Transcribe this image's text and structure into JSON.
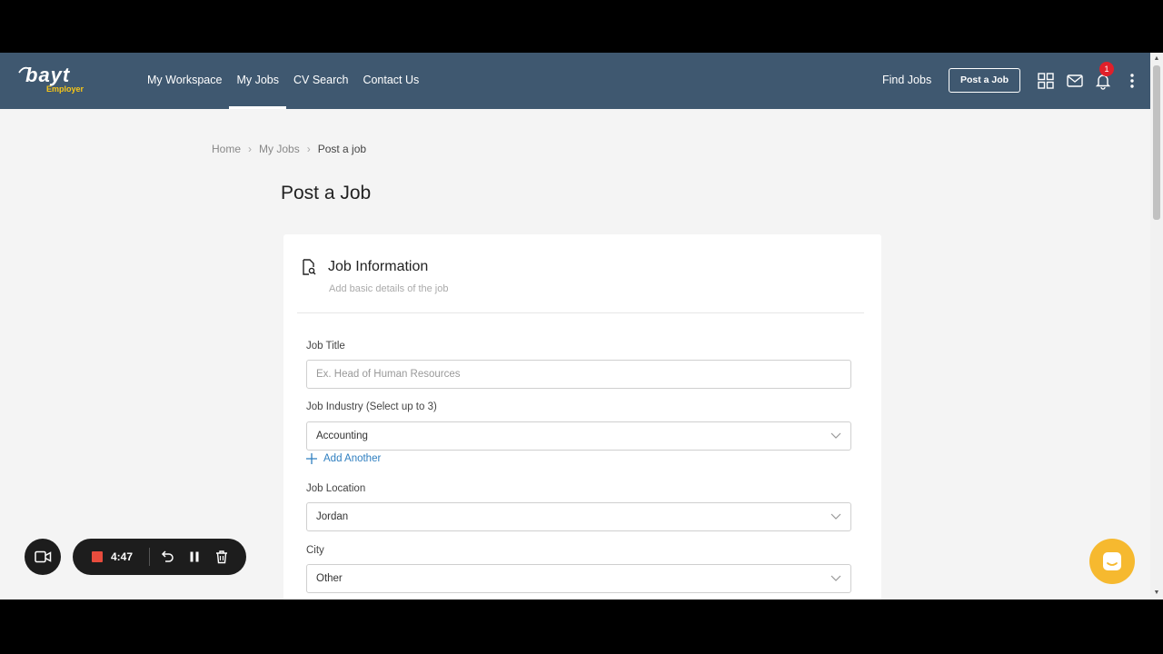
{
  "header": {
    "logo_text": "bayt",
    "logo_sub": "Employer",
    "nav": [
      {
        "label": "My Workspace"
      },
      {
        "label": "My Jobs"
      },
      {
        "label": "CV Search"
      },
      {
        "label": "Contact Us"
      }
    ],
    "find_jobs": "Find Jobs",
    "post_job": "Post a Job",
    "notification_count": "1"
  },
  "breadcrumb": {
    "home": "Home",
    "my_jobs": "My Jobs",
    "current": "Post a job"
  },
  "page": {
    "title": "Post a Job"
  },
  "card": {
    "title": "Job Information",
    "subtitle": "Add basic details of the job"
  },
  "form": {
    "job_title_label": "Job Title",
    "job_title_placeholder": "Ex. Head of Human Resources",
    "industry_label": "Job Industry (Select up to 3)",
    "industry_value": "Accounting",
    "add_another": "Add Another",
    "location_label": "Job Location",
    "location_value": "Jordan",
    "city_label": "City",
    "city_value": "Other"
  },
  "recorder": {
    "time": "4:47"
  },
  "colors": {
    "header_bg": "#3f5870",
    "page_bg": "#f4f4f4",
    "link": "#2f7fc0",
    "logo_accent": "#f5c518",
    "badge": "#e0202a",
    "chat": "#f6b92f",
    "record": "#e84c3d"
  },
  "icons": [
    "grid-icon",
    "mail-icon",
    "bell-icon",
    "more-vertical-icon",
    "document-search-icon",
    "chevron-down-icon",
    "plus-icon",
    "video-camera-icon",
    "undo-icon",
    "pause-icon",
    "trash-icon",
    "chat-icon"
  ]
}
